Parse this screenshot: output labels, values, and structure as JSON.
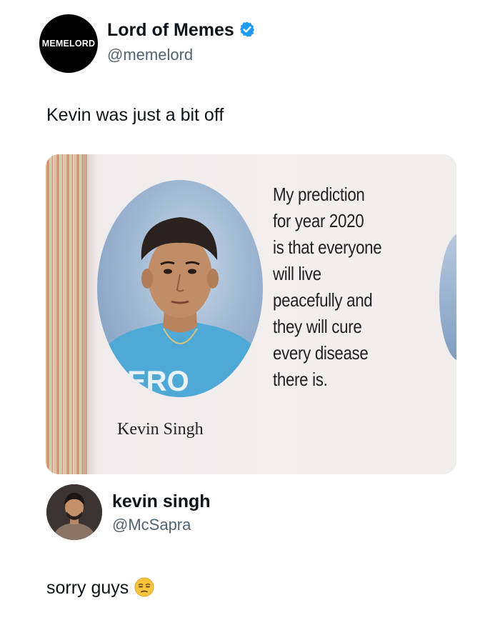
{
  "post": {
    "avatar_text": "MEMELORD",
    "author_name": "Lord of Memes",
    "author_handle": "@memelord",
    "text": "Kevin was just a bit off"
  },
  "media": {
    "portrait_name": "Kevin Singh",
    "shirt_text": "ERO",
    "prediction_lines": [
      "My prediction",
      "for year 2020",
      "is that everyone",
      "will live",
      "peacefully and",
      "they will cure",
      "every disease",
      "there is."
    ]
  },
  "reply": {
    "author_name": "kevin singh",
    "author_handle": "@McSapra",
    "text": "sorry guys"
  },
  "icons": {
    "verified": "verified-badge-icon",
    "emoji": "unamused-face-emoji-icon"
  },
  "colors": {
    "verified_blue": "#1d9bf0",
    "handle_gray": "#536471",
    "text": "#0f1419"
  }
}
